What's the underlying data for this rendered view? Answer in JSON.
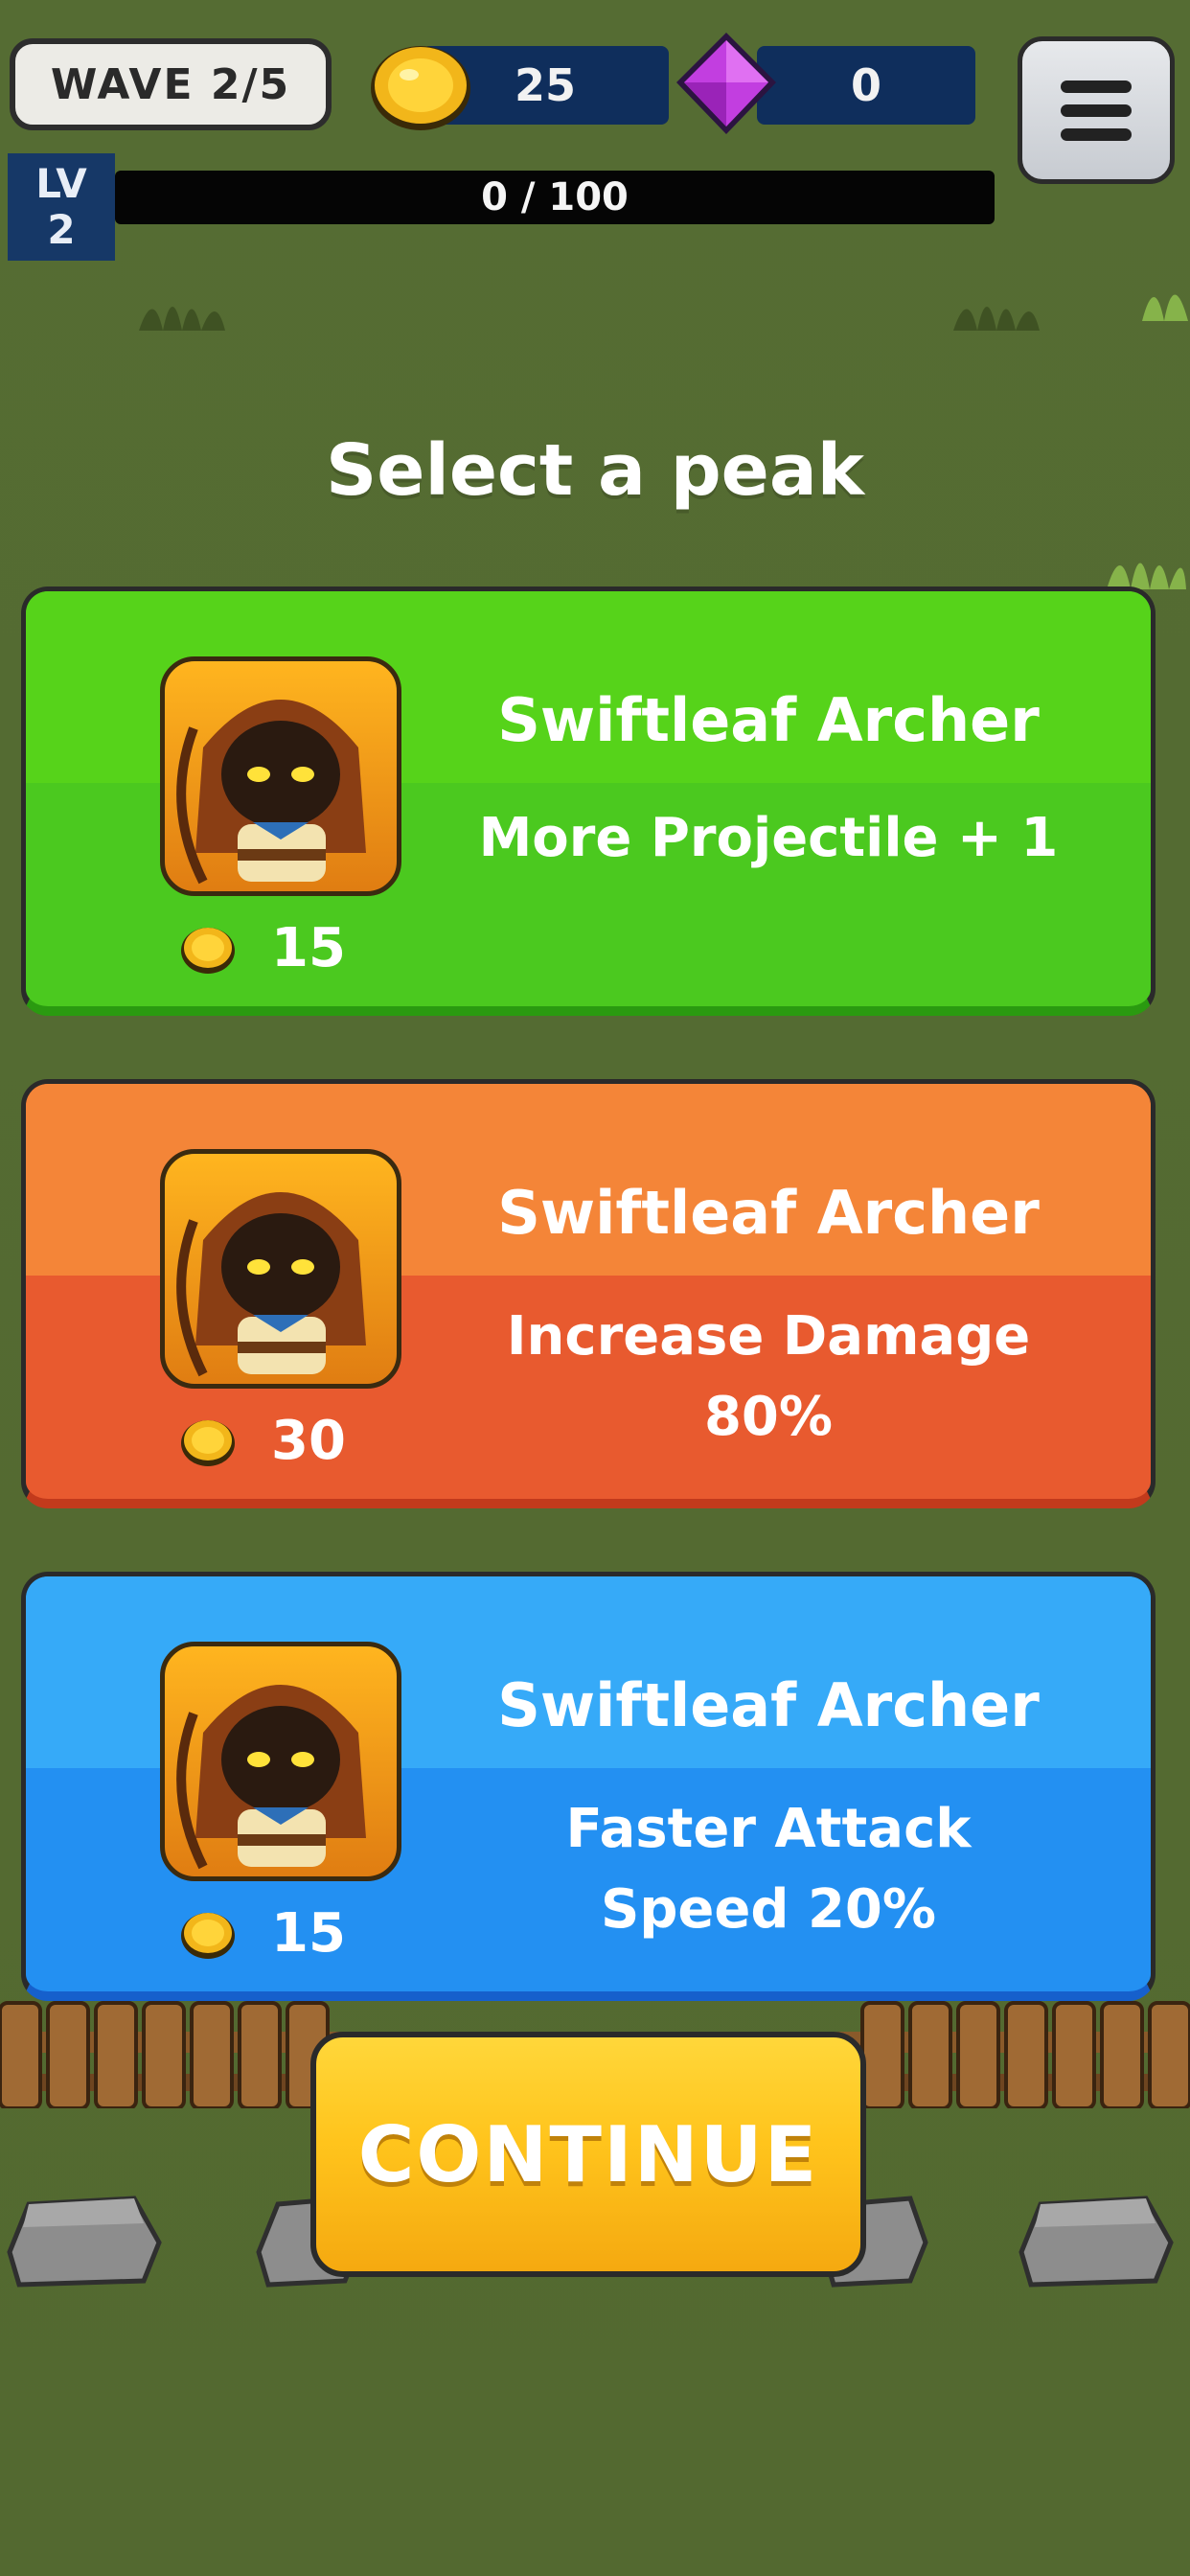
{
  "hud": {
    "wave_label": "WAVE 2/5",
    "gold": "25",
    "gems": "0",
    "level_label": "LV",
    "level_value": "2",
    "xp_text": "0 / 100",
    "menu_icon": "hamburger-menu-icon",
    "gold_icon": "gold-coin-icon",
    "gem_icon": "purple-gem-icon"
  },
  "title": "Select a peak",
  "perks": [
    {
      "name": "Swiftleaf Archer",
      "desc_line1": "More Projectile + 1",
      "desc_line2": "",
      "cost": "15",
      "color": "#4bc91f"
    },
    {
      "name": "Swiftleaf Archer",
      "desc_line1": "Increase Damage",
      "desc_line2": "80%",
      "cost": "30",
      "color": "#e85a2f"
    },
    {
      "name": "Swiftleaf Archer",
      "desc_line1": "Faster Attack",
      "desc_line2": "Speed 20%",
      "cost": "15",
      "color": "#2390f2"
    }
  ],
  "continue_label": "CONTINUE",
  "colors": {
    "field": "#556b32",
    "hud_bar": "#0f2e5c",
    "button": "#ffc41c"
  }
}
